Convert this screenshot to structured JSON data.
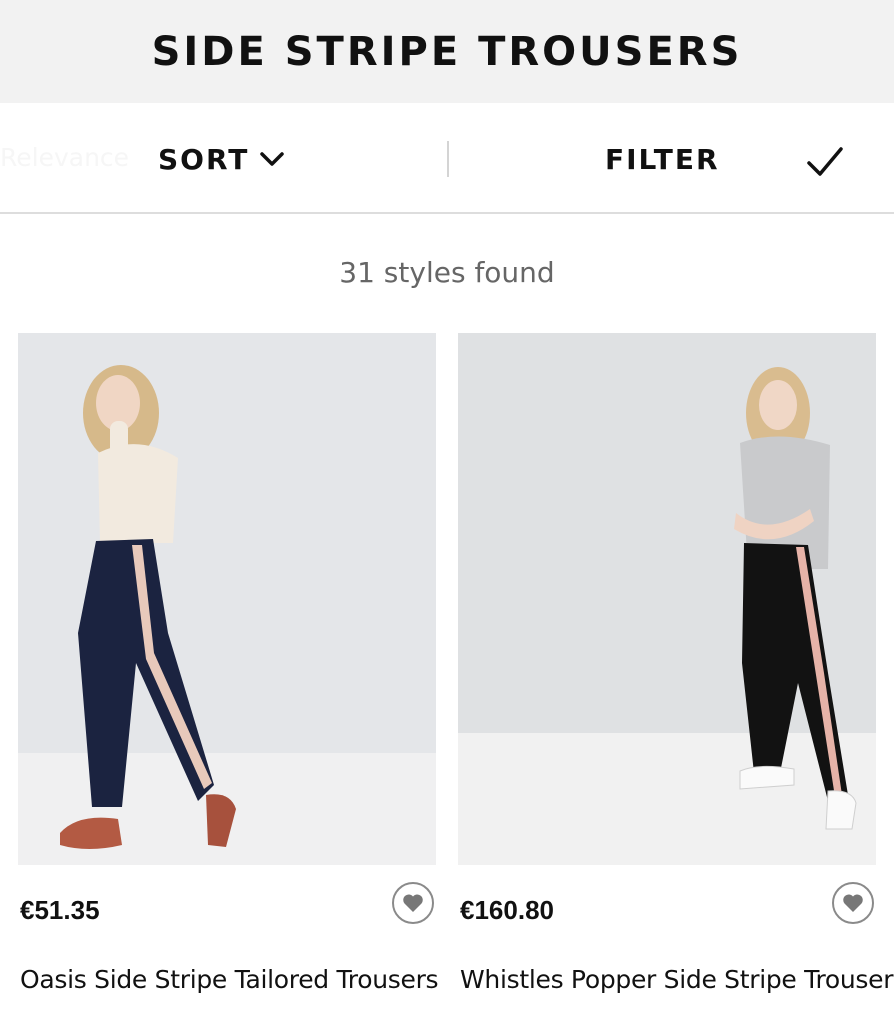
{
  "header": {
    "title": "SIDE STRIPE TROUSERS"
  },
  "toolbar": {
    "sort_hint": "Relevance",
    "sort_label": "SORT",
    "filter_label": "FILTER"
  },
  "results": {
    "count_text": "31 styles found"
  },
  "products": [
    {
      "price": "€51.35",
      "name": "Oasis Side Stripe Tailored Trousers",
      "trouser_color": "#1b2340",
      "stripe_color": "#e8c9bb"
    },
    {
      "price": "€160.80",
      "name": "Whistles Popper Side Stripe Trouser",
      "trouser_color": "#121212",
      "stripe_color": "#e6b3a8"
    }
  ],
  "icons": {
    "sort": "chevron-down-icon",
    "apply": "checkmark-icon",
    "wishlist": "heart-icon"
  }
}
